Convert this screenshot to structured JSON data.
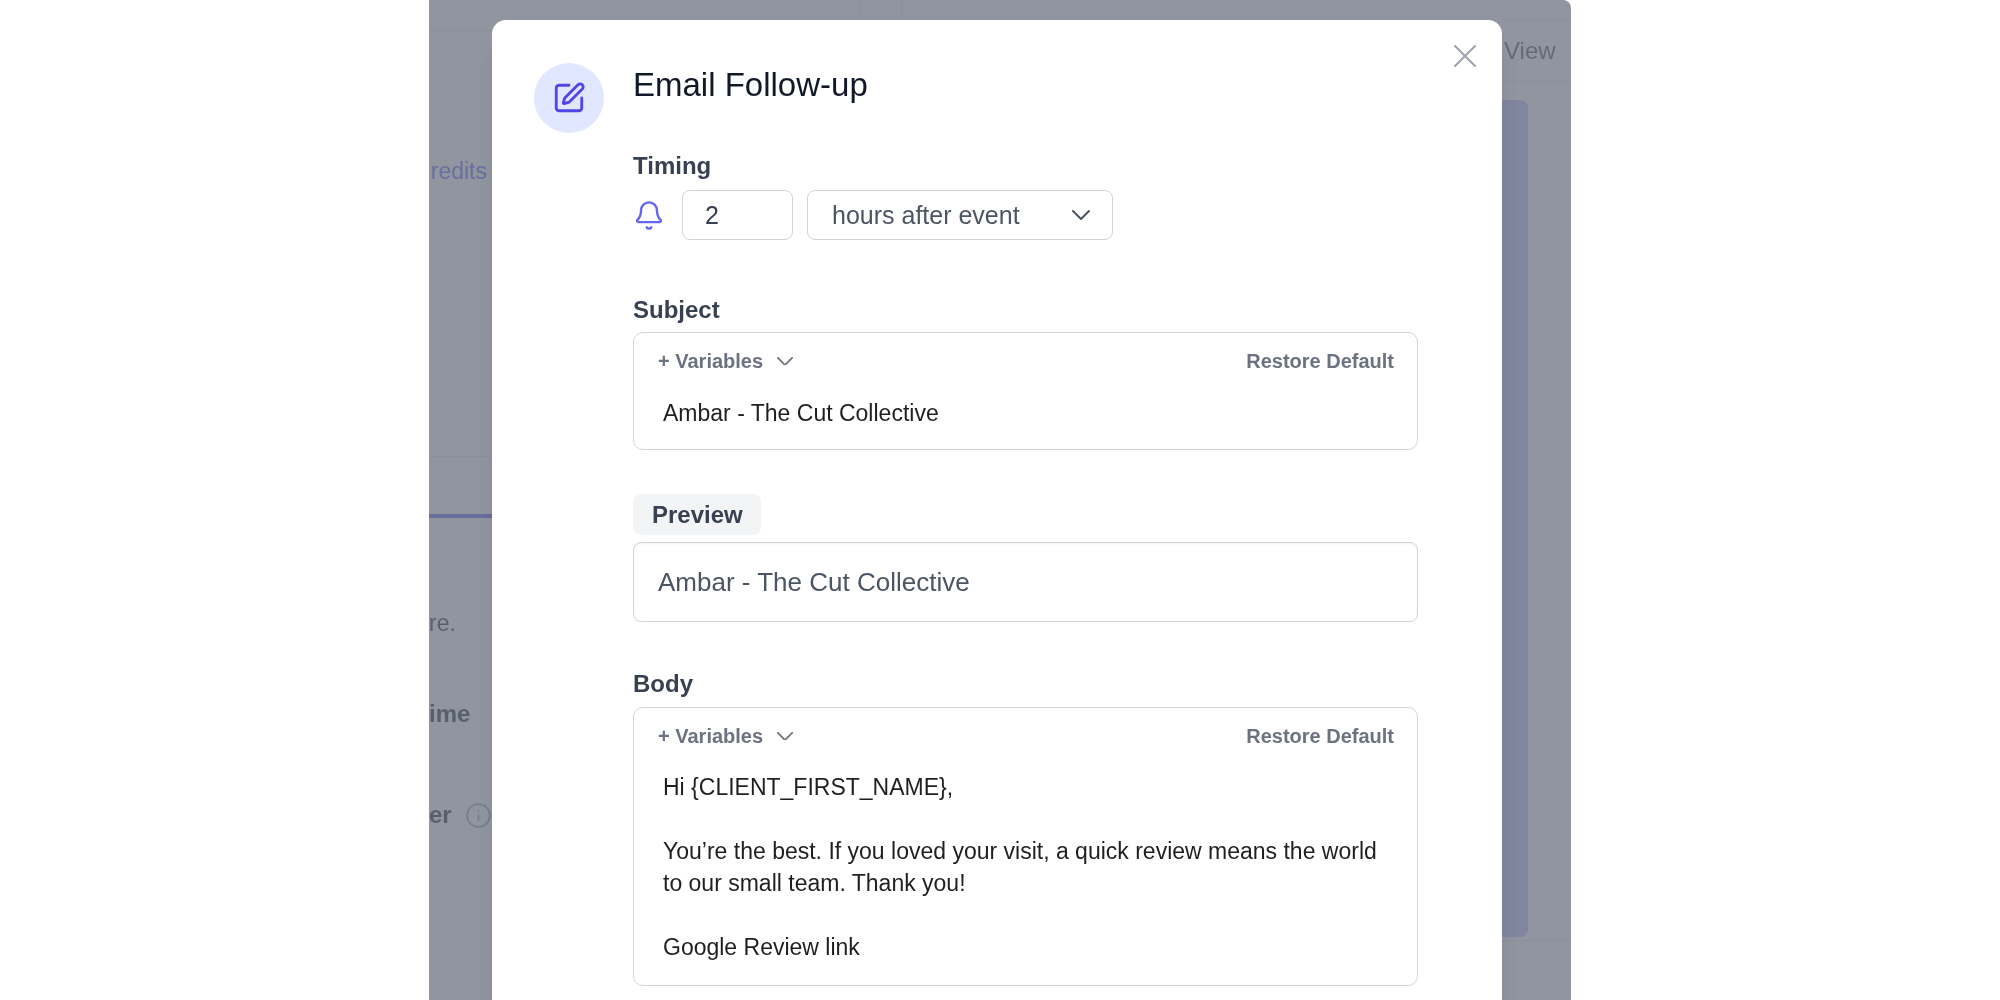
{
  "background": {
    "credits_link": "redits",
    "hint": "re.",
    "labels": [
      {
        "text": "ime",
        "info": false
      },
      {
        "text": "er",
        "info": true
      }
    ],
    "view_tab": "View"
  },
  "dialog": {
    "title": "Email Follow-up",
    "timing": {
      "label": "Timing",
      "amount": "2",
      "unit": "hours after event"
    },
    "subject": {
      "label": "Subject",
      "variables": "+ Variables",
      "restore": "Restore Default",
      "value": "Ambar - The Cut Collective"
    },
    "preview": {
      "label": "Preview",
      "value": "Ambar - The Cut Collective"
    },
    "body": {
      "label": "Body",
      "variables": "+ Variables",
      "restore": "Restore Default",
      "paragraphs": [
        "Hi {CLIENT_FIRST_NAME},",
        "You’re the best. If you loved your visit, a quick review means the world to our small team. Thank you!",
        "Google Review link"
      ]
    }
  }
}
